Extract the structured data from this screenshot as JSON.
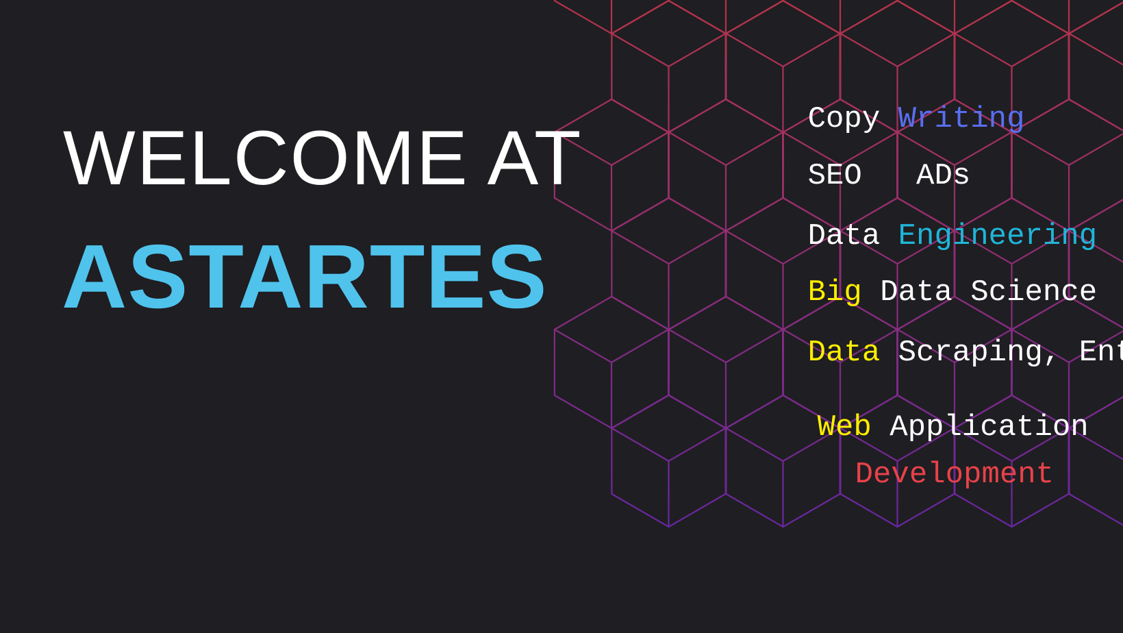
{
  "hero": {
    "welcome_text": "WELCOME AT",
    "brand_name": "ASTARTES"
  },
  "services": [
    {
      "parts": [
        {
          "text": "Copy ",
          "color": "#ffffff"
        },
        {
          "text": "Writing",
          "color": "#5a6ef0"
        }
      ]
    },
    {
      "parts": [
        {
          "text": "SEO   ADs",
          "color": "#ffffff"
        }
      ]
    },
    {
      "parts": [
        {
          "text": "Data ",
          "color": "#ffffff"
        },
        {
          "text": "Engineering",
          "color": "#1fb6d8"
        }
      ]
    },
    {
      "parts": [
        {
          "text": "Big",
          "color": "#ffee00"
        },
        {
          "text": " Data Science",
          "color": "#ffffff"
        }
      ]
    },
    {
      "parts": [
        {
          "text": "Data",
          "color": "#ffee00"
        },
        {
          "text": " Scraping, Entry",
          "color": "#ffffff"
        }
      ]
    },
    {
      "parts": [
        {
          "text": "Web",
          "color": "#ffee00"
        },
        {
          "text": " Application",
          "color": "#ffffff"
        }
      ]
    },
    {
      "parts": [
        {
          "text": "Development",
          "color": "#e8424a"
        }
      ]
    }
  ],
  "colors": {
    "background": "#1f1e22",
    "welcome": "#ffffff",
    "brand": "#4fc3ec",
    "pattern_top": "#b4344a",
    "pattern_bottom": "#5a24b4"
  },
  "decoration": {
    "pattern_name": "isometric-cube-grid"
  }
}
